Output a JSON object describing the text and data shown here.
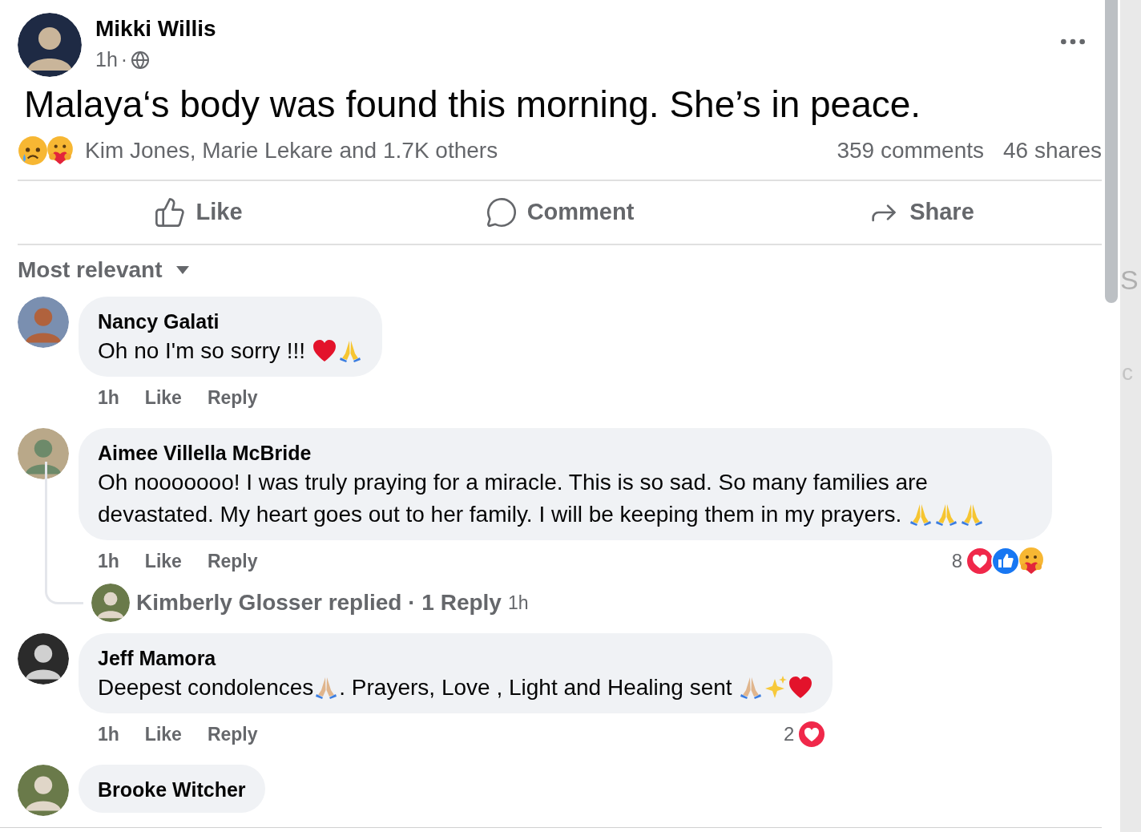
{
  "post": {
    "author": "Mikki Willis",
    "time": "1h",
    "separator": "·",
    "text": "Malaya‘s body was found this morning. She’s in peace."
  },
  "reactions": {
    "icons": [
      {
        "kind": "sad"
      },
      {
        "kind": "care"
      }
    ],
    "summary": "Kim Jones, Marie Lekare and 1.7K others",
    "comments": "359 comments",
    "shares": "46 shares"
  },
  "actions": [
    {
      "kind": "like",
      "label": "Like"
    },
    {
      "kind": "comment",
      "label": "Comment"
    },
    {
      "kind": "share",
      "label": "Share"
    }
  ],
  "sort": {
    "label": "Most relevant"
  },
  "comments": [
    {
      "author": "Nancy Galati",
      "segments": [
        {
          "kind": "text",
          "text": "Oh no I'm so sorry !!! "
        },
        {
          "kind": "heart"
        },
        {
          "kind": "pray"
        }
      ],
      "time": "1h",
      "like": "Like",
      "reply": "Reply"
    },
    {
      "author": "Aimee Villella McBride",
      "segments": [
        {
          "kind": "text",
          "text": "Oh nooooooo! I was truly praying for a miracle. This is so sad. So many families are devastated. My heart goes out to her family. I will be keeping them in my prayers. "
        },
        {
          "kind": "pray"
        },
        {
          "kind": "pray"
        },
        {
          "kind": "pray"
        }
      ],
      "time": "1h",
      "like": "Like",
      "reply": "Reply",
      "reaction_count": "8",
      "reaction_icons": [
        {
          "kind": "heart"
        },
        {
          "kind": "like"
        },
        {
          "kind": "care"
        }
      ],
      "replies": {
        "text": "Kimberly Glosser replied · 1 Reply",
        "time": "1h"
      }
    },
    {
      "author": "Jeff Mamora",
      "segments": [
        {
          "kind": "text",
          "text": "Deepest condolences"
        },
        {
          "kind": "pray-tone"
        },
        {
          "kind": "text",
          "text": ". Prayers, Love , Light and Healing sent "
        },
        {
          "kind": "pray-tone"
        },
        {
          "kind": "sparkles"
        },
        {
          "kind": "heart"
        }
      ],
      "time": "1h",
      "like": "Like",
      "reply": "Reply",
      "reaction_count": "2",
      "reaction_icons": [
        {
          "kind": "heart"
        }
      ]
    },
    {
      "author": "Brooke Witcher"
    }
  ],
  "background_panel": {
    "texts": [
      "S",
      "c"
    ]
  }
}
